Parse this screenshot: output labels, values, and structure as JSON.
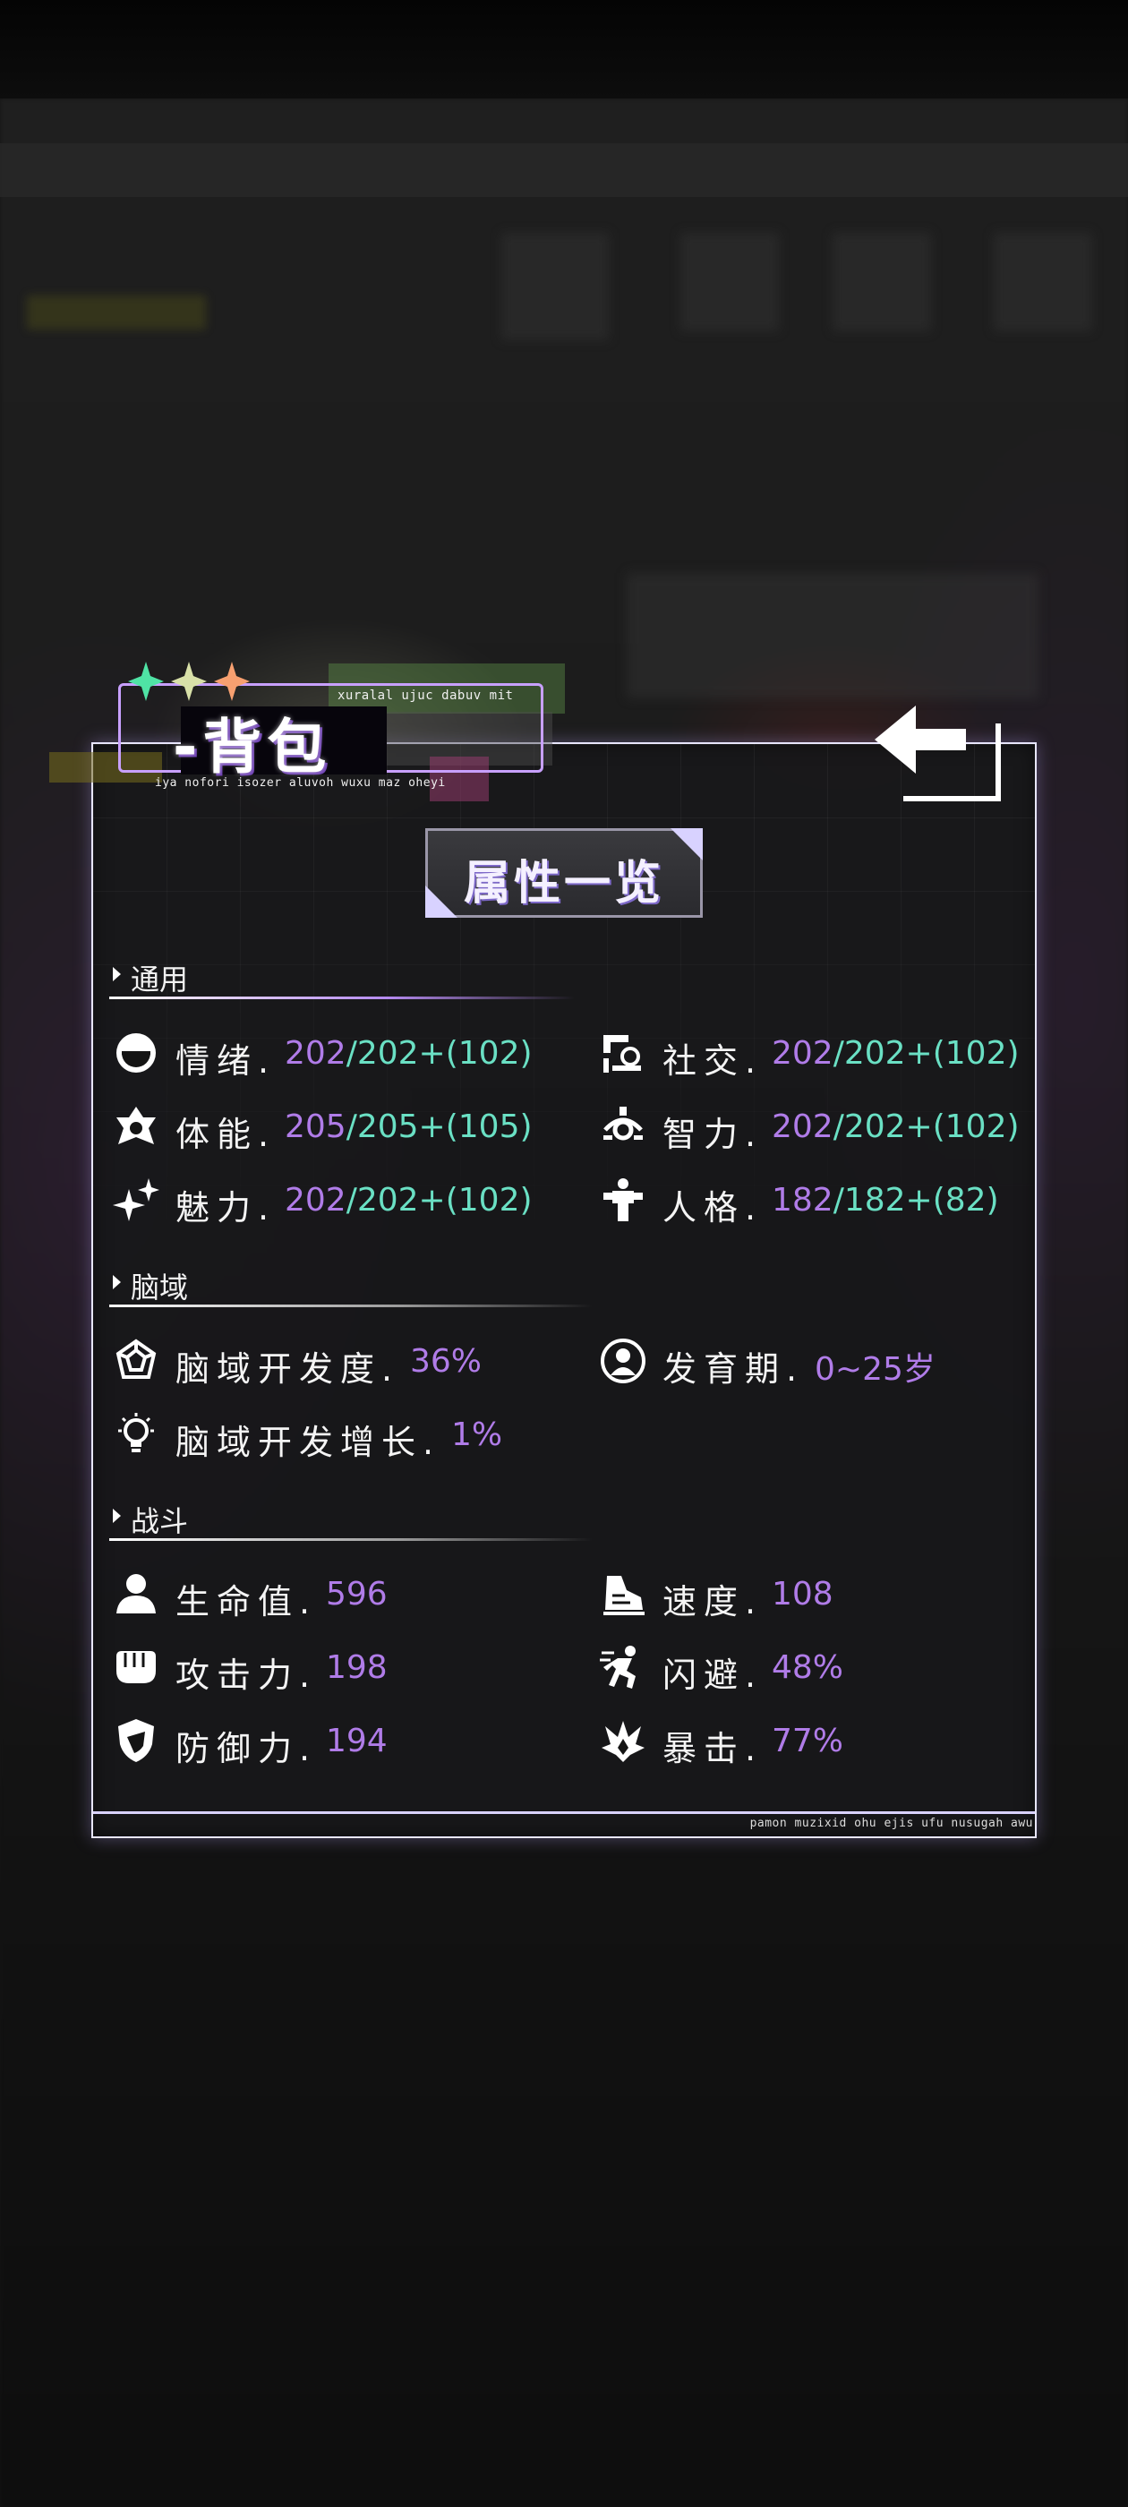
{
  "title": {
    "main": "-背包",
    "sub_top": "xuralal ujuc dabuv mit",
    "sub_bottom": "iya nofori isozer aluvoh wuxu maz oheyi"
  },
  "heading": "属性一览",
  "footer_text": "pamon muzixid ohu ejis ufu nusugah awu",
  "sections": {
    "general": {
      "label": "通用",
      "stats": [
        {
          "name": "情绪.",
          "value": "202",
          "rest": "/202+(102)",
          "icon": "mood-icon"
        },
        {
          "name": "社交.",
          "value": "202",
          "rest": "/202+(102)",
          "icon": "social-icon"
        },
        {
          "name": "体能.",
          "value": "205",
          "rest": "/205+(105)",
          "icon": "stamina-icon"
        },
        {
          "name": "智力.",
          "value": "202",
          "rest": "/202+(102)",
          "icon": "intellect-icon"
        },
        {
          "name": "魅力.",
          "value": "202",
          "rest": "/202+(102)",
          "icon": "charm-icon"
        },
        {
          "name": "人格.",
          "value": "182",
          "rest": "/182+(82)",
          "icon": "personality-icon"
        }
      ]
    },
    "brain": {
      "label": "脑域",
      "stats": [
        {
          "name": "脑域开发度.",
          "value": "36%",
          "icon": "brain-development-icon"
        },
        {
          "name": "发育期.",
          "value": "0~25岁",
          "icon": "growth-period-icon"
        },
        {
          "name": "脑域开发增长.",
          "value": "1%",
          "icon": "lightbulb-icon"
        }
      ]
    },
    "combat": {
      "label": "战斗",
      "stats": [
        {
          "name": "生命值.",
          "value": "596",
          "icon": "health-icon"
        },
        {
          "name": "速度.",
          "value": "108",
          "icon": "speed-icon"
        },
        {
          "name": "攻击力.",
          "value": "198",
          "icon": "attack-icon"
        },
        {
          "name": "闪避.",
          "value": "48%",
          "icon": "dodge-icon"
        },
        {
          "name": "防御力.",
          "value": "194",
          "icon": "defense-icon"
        },
        {
          "name": "暴击.",
          "value": "77%",
          "icon": "critical-icon"
        }
      ]
    }
  },
  "colors": {
    "accent_purple": "#b07ce8",
    "accent_teal": "#6ae0c4",
    "panel_border": "#e8e6ff"
  }
}
